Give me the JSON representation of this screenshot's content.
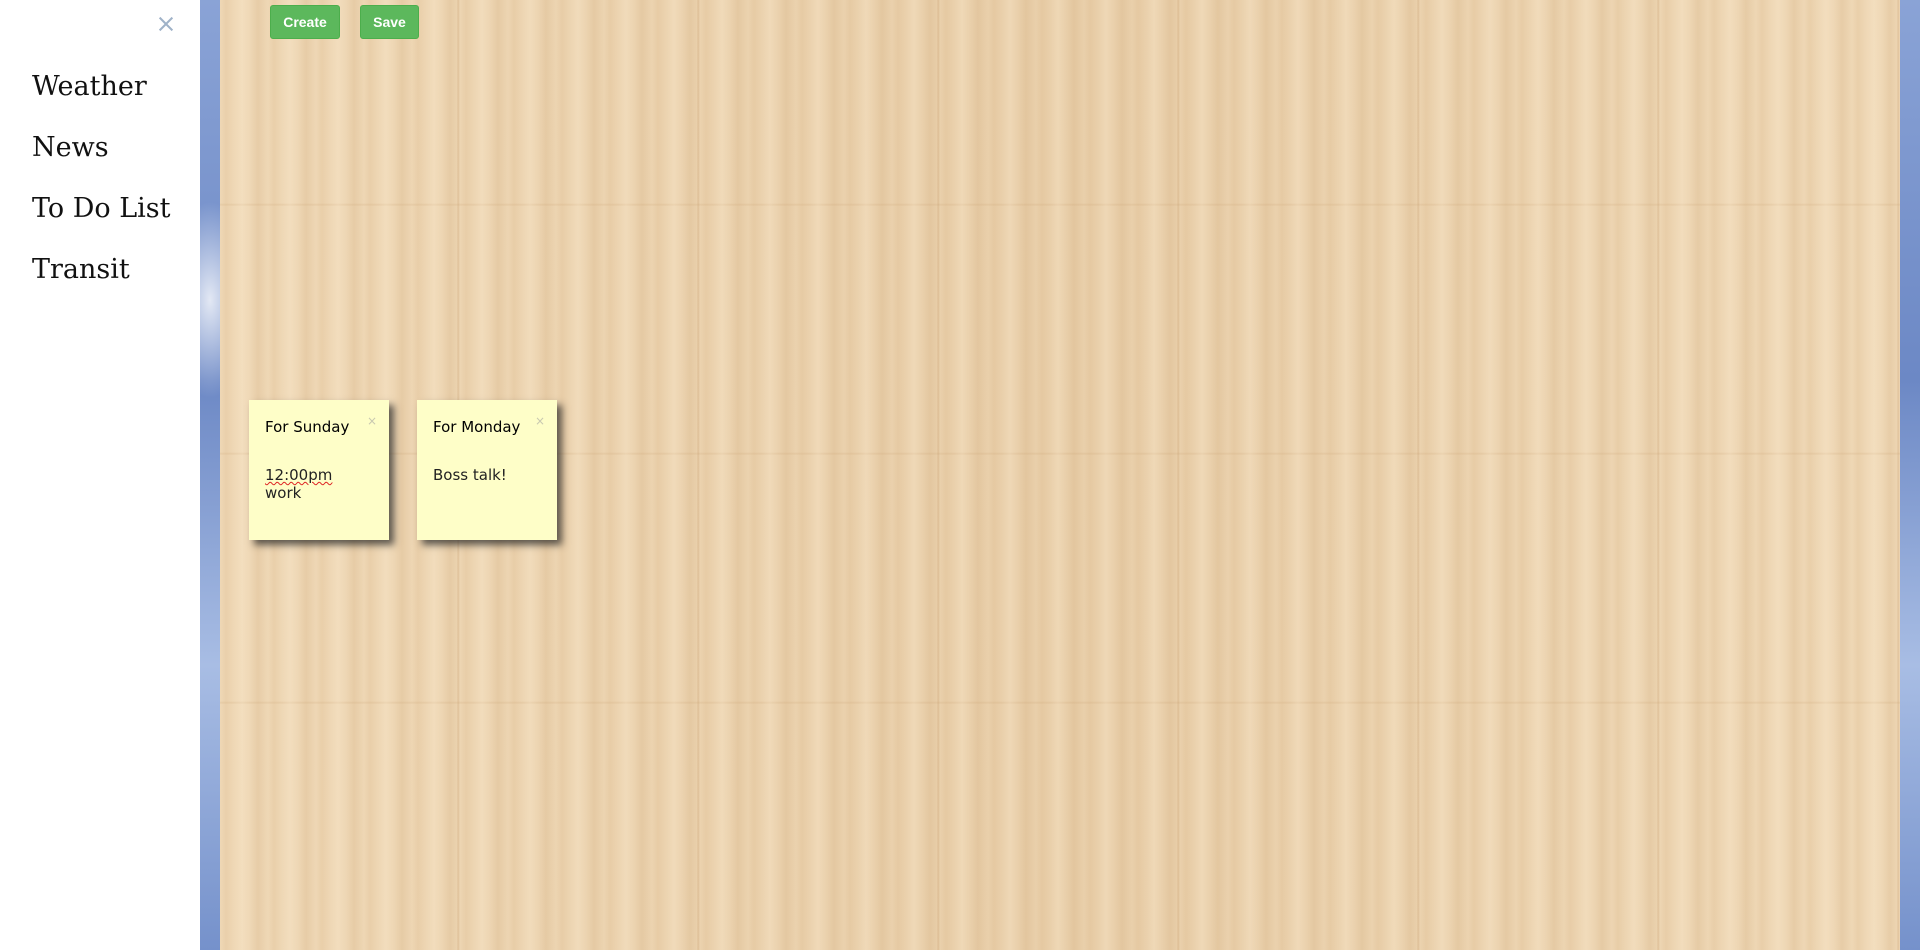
{
  "sidebar": {
    "close_label": "×",
    "items": [
      {
        "label": "Weather"
      },
      {
        "label": "News"
      },
      {
        "label": "To Do List"
      },
      {
        "label": "Transit"
      }
    ]
  },
  "toolbar": {
    "create_label": "Create",
    "save_label": "Save"
  },
  "notes": [
    {
      "title": "For Sunday",
      "body_time": "12:00pm",
      "body_rest": " work",
      "close": "×"
    },
    {
      "title": "For Monday",
      "body": "Boss talk!",
      "close": "×"
    }
  ],
  "colors": {
    "button_green": "#5cb85c",
    "note_yellow": "#fefec8",
    "sidebar_bg": "#ffffff",
    "board_wood": "#ecd4b1"
  }
}
